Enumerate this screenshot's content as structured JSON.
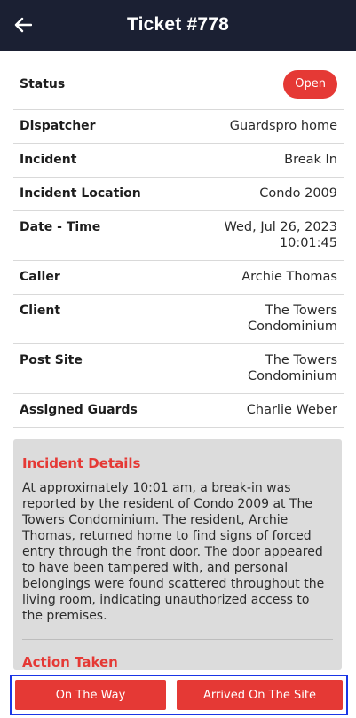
{
  "header": {
    "title": "Ticket #778",
    "back_icon": "arrow-left-icon"
  },
  "status": {
    "label": "Status",
    "value": "Open",
    "color": "#e53935"
  },
  "details": [
    {
      "label": "Dispatcher",
      "value": "Guardspro home"
    },
    {
      "label": "Incident",
      "value": "Break In"
    },
    {
      "label": "Incident Location",
      "value": "Condo 2009"
    },
    {
      "label": "Date - Time",
      "value": "Wed, Jul 26, 2023\n10:01:45"
    },
    {
      "label": "Caller",
      "value": "Archie Thomas"
    },
    {
      "label": "Client",
      "value": "The Towers\nCondominium"
    },
    {
      "label": "Post Site",
      "value": "The Towers\nCondominium"
    },
    {
      "label": "Assigned Guards",
      "value": "Charlie Weber"
    }
  ],
  "incident_details": {
    "heading": "Incident Details",
    "text": "At approximately 10:01 am, a break-in was reported by the resident of Condo 2009 at The Towers Condominium. The resident, Archie Thomas, returned home to find signs of forced entry through the front door. The door appeared to have been tampered with, and personal belongings were found scattered throughout the living room, indicating unauthorized access to the premises."
  },
  "action_taken": {
    "heading": "Action Taken"
  },
  "actions": {
    "on_the_way": "On The Way",
    "arrived": "Arrived On The Site"
  },
  "colors": {
    "appbar": "#1b2033",
    "accent": "#e53935",
    "highlight_border": "#1a36e6"
  }
}
